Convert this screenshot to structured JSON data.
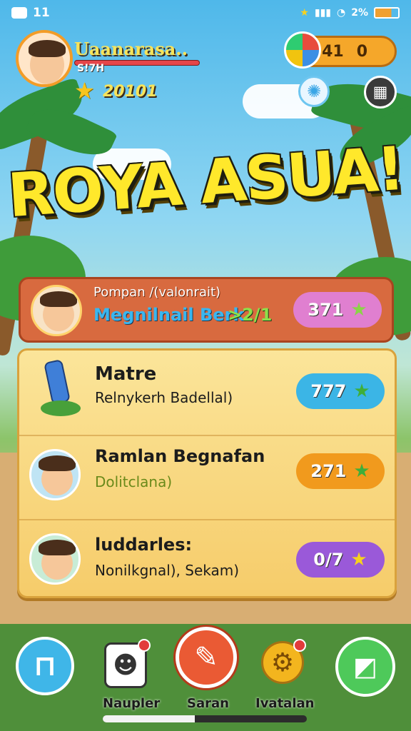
{
  "status_bar": {
    "time": "11",
    "battery": "2%"
  },
  "player": {
    "name": "Uaanarasa..",
    "sub": "S!7H",
    "score": "20101"
  },
  "currency": {
    "a": "41",
    "b": "0"
  },
  "title": "ROYA ASUA!",
  "top_card": {
    "line1": "Pompan /(valonrait)",
    "line2": "Megnilnail Berk",
    "line3": ">2/1",
    "pill_value": "371",
    "pill_color": "#e07fd0"
  },
  "rows": [
    {
      "title": "Matre",
      "sub": "Relnykerh Badellal)",
      "pill_value": "777",
      "pill_color": "#3bb5e6"
    },
    {
      "title": "Ramlan Begnafan",
      "sub": "Dolitclana)",
      "pill_value": "271",
      "pill_color": "#f19a1d"
    },
    {
      "title": "luddarles:",
      "sub": "Nonilkgnal), Sekam)",
      "pill_value": "0/7",
      "pill_color": "#9a59d9"
    }
  ],
  "nav": {
    "label_left": "Naupler",
    "label_center": "Saran",
    "label_right": "Ivatalan",
    "progress": 0.45
  },
  "icons": [
    "message-icon",
    "star-icon",
    "palette-icon",
    "sun-icon",
    "grid-icon",
    "home-icon",
    "profile-icon",
    "pencil-icon",
    "gear-icon",
    "check-icon"
  ]
}
